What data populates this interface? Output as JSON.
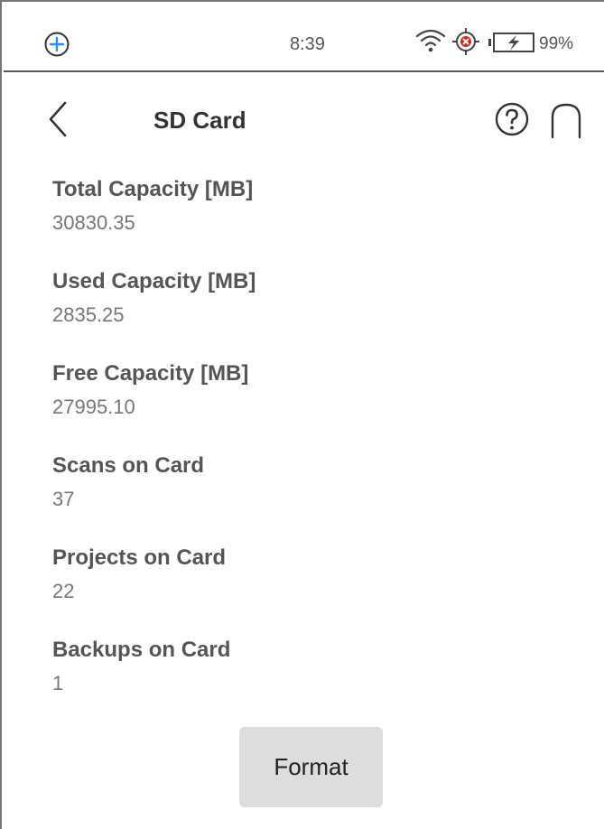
{
  "status_bar": {
    "time": "8:39",
    "battery_percent": "99%",
    "icons": [
      "add-circle-icon",
      "wifi-icon",
      "target-error-icon",
      "battery-charging-icon"
    ],
    "colors": {
      "add_icon": "#1e90ff",
      "error_icon": "#e02020"
    }
  },
  "header": {
    "title": "SD Card",
    "icons": [
      "chevron-left-icon",
      "help-icon",
      "home-icon"
    ]
  },
  "info": {
    "items": [
      {
        "label": "Total Capacity [MB]",
        "value": "30830.35"
      },
      {
        "label": "Used Capacity [MB]",
        "value": "2835.25"
      },
      {
        "label": "Free Capacity [MB]",
        "value": "27995.10"
      },
      {
        "label": "Scans on Card",
        "value": "37"
      },
      {
        "label": "Projects on Card",
        "value": "22"
      },
      {
        "label": "Backups on Card",
        "value": "1"
      }
    ]
  },
  "actions": {
    "format_label": "Format"
  }
}
